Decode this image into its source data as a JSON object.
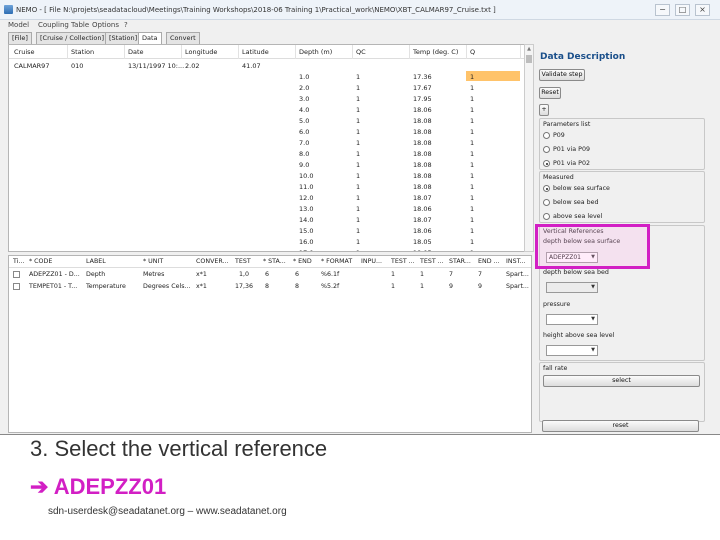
{
  "window": {
    "title": "NEMO - [ File N:\\projets\\seadatacloud\\Meetings\\Training Workshops\\2018-06 Training 1\\Practical_work\\NEMO\\XBT_CALMAR97_Cruise.txt ]",
    "minimize": "−",
    "maximize": "□",
    "close": "×"
  },
  "menu": [
    "Model",
    "Coupling Table",
    "Options",
    "?"
  ],
  "tabs": [
    "[File]",
    "[Cruise / Collection]",
    "[Station]",
    "Data",
    "Convert"
  ],
  "table": {
    "headers": [
      "Cruise",
      "Station",
      "Date",
      "Longitude",
      "Latitude",
      "Depth (m)",
      "QC",
      "Temp (deg. C)",
      "Q"
    ],
    "first_row": {
      "cruise": "CALMAR97",
      "station": "010",
      "date": "13/11/1997 10:...",
      "longitude": "2.02",
      "latitude": "41.07"
    },
    "rows": [
      [
        "1.0",
        "1",
        "17.36",
        "1"
      ],
      [
        "2.0",
        "1",
        "17.67",
        "1"
      ],
      [
        "3.0",
        "1",
        "17.95",
        "1"
      ],
      [
        "4.0",
        "1",
        "18.06",
        "1"
      ],
      [
        "5.0",
        "1",
        "18.08",
        "1"
      ],
      [
        "6.0",
        "1",
        "18.08",
        "1"
      ],
      [
        "7.0",
        "1",
        "18.08",
        "1"
      ],
      [
        "8.0",
        "1",
        "18.08",
        "1"
      ],
      [
        "9.0",
        "1",
        "18.08",
        "1"
      ],
      [
        "10.0",
        "1",
        "18.08",
        "1"
      ],
      [
        "11.0",
        "1",
        "18.08",
        "1"
      ],
      [
        "12.0",
        "1",
        "18.07",
        "1"
      ],
      [
        "13.0",
        "1",
        "18.06",
        "1"
      ],
      [
        "14.0",
        "1",
        "18.07",
        "1"
      ],
      [
        "15.0",
        "1",
        "18.06",
        "1"
      ],
      [
        "16.0",
        "1",
        "18.05",
        "1"
      ],
      [
        "17.0",
        "1",
        "18.05",
        "1"
      ],
      [
        "18.0",
        "1",
        "18.04",
        "1"
      ]
    ]
  },
  "params_table": {
    "headers": [
      "Ti...",
      "* CODE",
      "LABEL",
      "* UNIT",
      "CONVER...",
      "TEST",
      "* STA...",
      "* END",
      "* FORMAT",
      "INPU...",
      "TEST ...",
      "TEST ...",
      "STAR...",
      "END ...",
      "INST..."
    ],
    "rows": [
      [
        "ADEPZZ01 - D...",
        "Depth",
        "Metres",
        "x*1",
        "1,0",
        "6",
        "6",
        "%6.1f",
        "",
        "1",
        "1",
        "7",
        "7",
        "Spart..."
      ],
      [
        "TEMPET01 - T...",
        "Temperature",
        "Degrees Cels...",
        "x*1",
        "17,36",
        "8",
        "8",
        "%5.2f",
        "",
        "1",
        "1",
        "9",
        "9",
        "Spart..."
      ]
    ]
  },
  "panel": {
    "title": "Data Description",
    "validate": "Validate step",
    "reset": "Reset",
    "plus": "+",
    "parameters_list": {
      "label": "Parameters list",
      "options": [
        "P09",
        "P01 via P09",
        "P01 via P02"
      ]
    },
    "measured": {
      "label": "Measured",
      "options": [
        "below sea surface",
        "below sea bed",
        "above sea level"
      ]
    },
    "vertical_refs": {
      "label": "Vertical References",
      "depth_below_surface": "depth below sea surface",
      "selected": "ADEPZZ01",
      "depth_below_bed": "depth below sea bed",
      "pressure": "pressure",
      "height_above_sea": "height above sea level"
    },
    "fall_rate": "fall rate",
    "select": "select",
    "reset_bottom": "reset"
  },
  "caption": {
    "step": "3. Select the vertical reference",
    "arrow": "➔",
    "code": "ADEPZZ01"
  },
  "footer": "sdn-userdesk@seadatanet.org – www.seadatanet.org",
  "colors": {
    "highlight_border": "#d21fc4",
    "q_cell": "#ffc36a",
    "panel_title": "#1a4f8a"
  }
}
